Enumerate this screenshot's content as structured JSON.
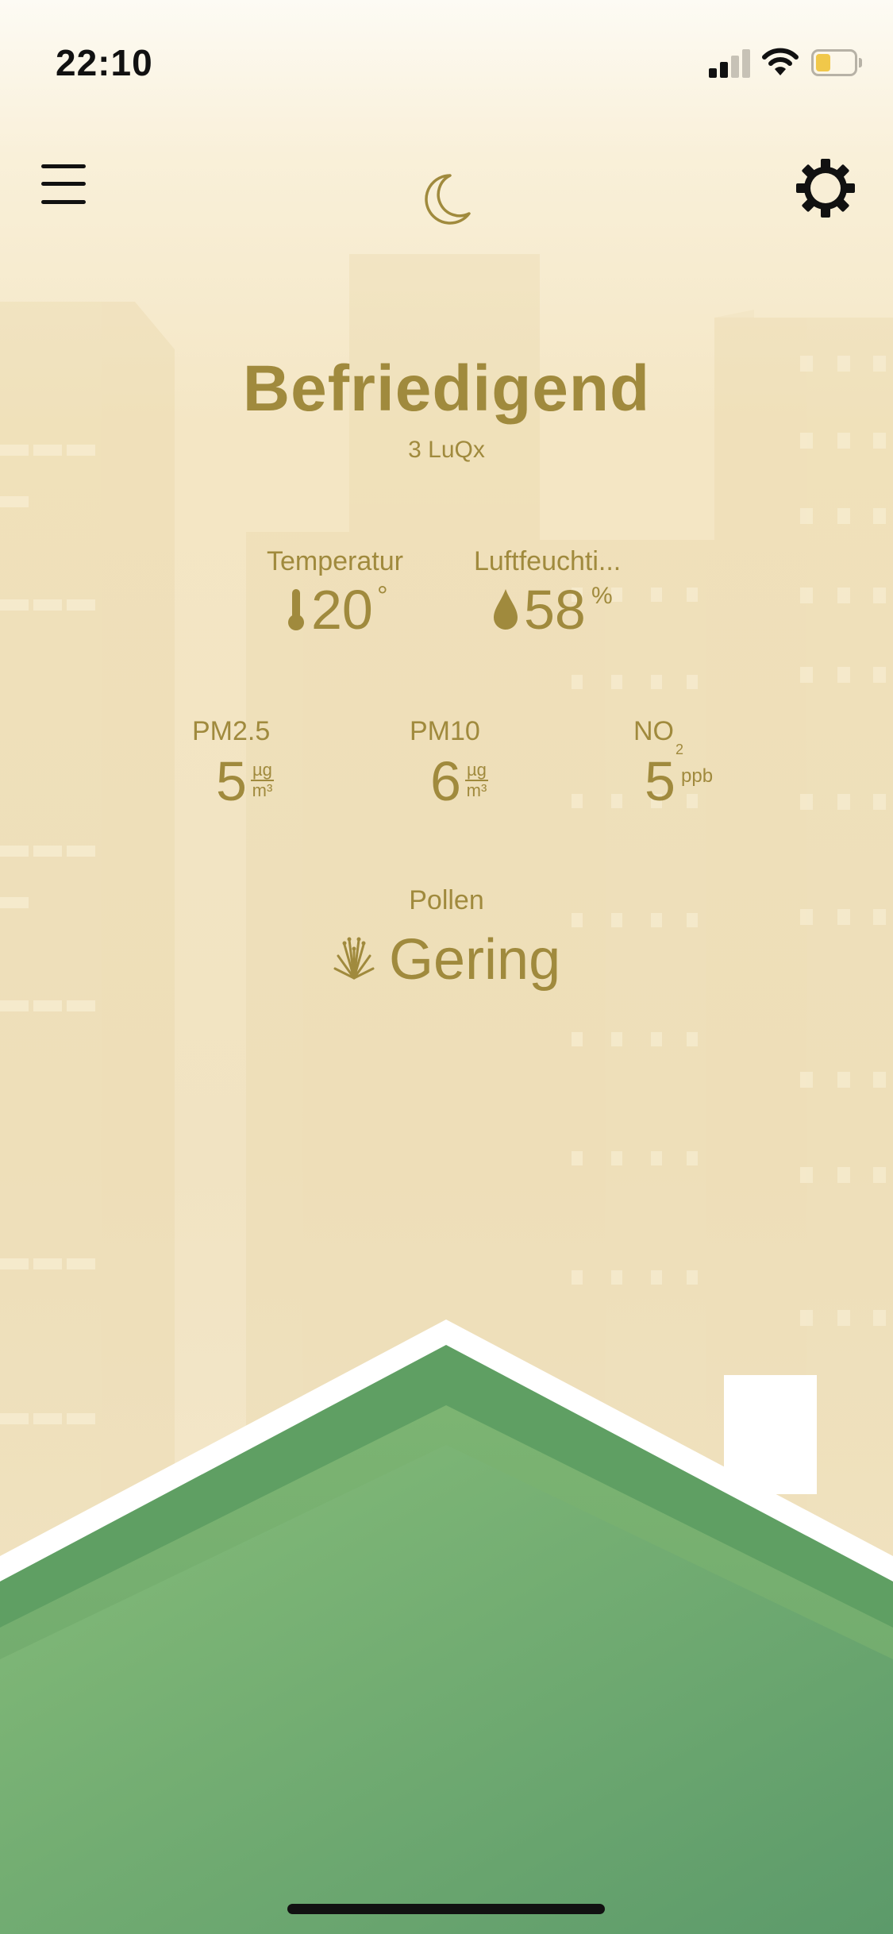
{
  "status_bar": {
    "time": "22:10",
    "battery_level": 0.4,
    "icons": [
      "cellular-signal-icon",
      "wifi-icon",
      "battery-icon"
    ]
  },
  "nav": {
    "menu_icon": "menu-icon",
    "mode_icon": "moon-icon",
    "settings_icon": "gear-icon"
  },
  "air_quality": {
    "rating": "Befriedigend",
    "index": "3 LuQx"
  },
  "climate": {
    "temperature": {
      "label": "Temperatur",
      "value": "20",
      "unit": "°",
      "icon": "thermometer-icon"
    },
    "humidity": {
      "label": "Luftfeuchti...",
      "value": "58",
      "unit": "%",
      "icon": "water-drop-icon"
    }
  },
  "pollutants": [
    {
      "label": "PM2.5",
      "value": "5",
      "unit_top": "µg",
      "unit_bottom": "m³"
    },
    {
      "label": "PM10",
      "value": "6",
      "unit_top": "µg",
      "unit_bottom": "m³"
    },
    {
      "label": "NO",
      "label_sub": "2",
      "value": "5",
      "unit": "ppb"
    }
  ],
  "pollen": {
    "label": "Pollen",
    "value": "Gering",
    "icon": "grass-icon"
  },
  "colors": {
    "accent": "#a08a3d",
    "roof_green": "#6fae6f",
    "background": "#f4e6c4"
  }
}
